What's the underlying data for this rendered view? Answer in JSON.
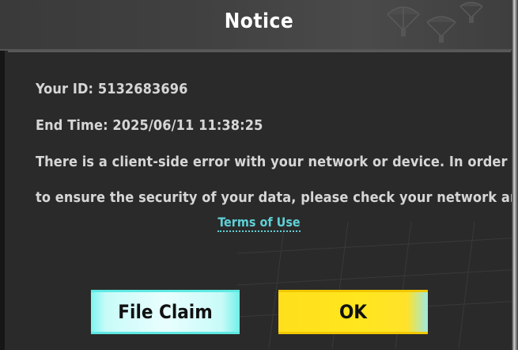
{
  "dialog": {
    "title": "Notice",
    "id_line": "Your ID: 5132683696",
    "end_time_line": "End Time: 2025/06/11 11:38:25",
    "message_line1": "There is a client-side error with your network or device. In order",
    "message_line2": "to ensure the security of your data, please check your network and",
    "terms_link": "Terms of Use"
  },
  "buttons": {
    "file_claim_label": "File Claim",
    "ok_label": "OK"
  },
  "colors": {
    "background": "#2a2a2a",
    "header": "#414141",
    "text": "#d6d6d6",
    "link": "#5fd0d6",
    "file_claim_button": "#c8fbf8",
    "ok_button": "#ffe61f"
  },
  "decorations": {
    "header_icon": "parachutes-icon",
    "background_pattern": "grid-pattern"
  }
}
